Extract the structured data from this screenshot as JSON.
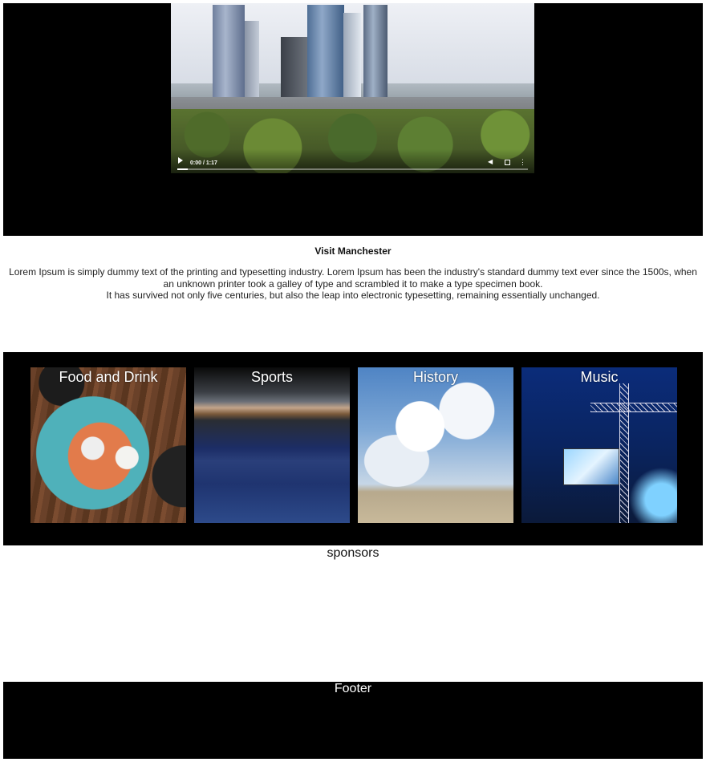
{
  "video": {
    "time": "0:00 / 1:17",
    "progress": 0.03
  },
  "intro": {
    "title": "Visit Manchester",
    "line1": "Lorem Ipsum is simply dummy text of the printing and typesetting industry. Lorem Ipsum has been the industry's standard dummy text ever since the 1500s, when an unknown printer took a galley of type and scrambled it to make a type specimen book.",
    "line2": "It has survived not only five centuries, but also the leap into electronic typesetting, remaining essentially unchanged."
  },
  "categories": [
    {
      "label": "Food and Drink"
    },
    {
      "label": "Sports"
    },
    {
      "label": "History"
    },
    {
      "label": "Music"
    }
  ],
  "sponsors": {
    "label": "sponsors"
  },
  "footer": {
    "label": "Footer"
  },
  "colors": {
    "section_bg": "#000000",
    "page_bg": "#ffffff",
    "text": "#111111"
  }
}
